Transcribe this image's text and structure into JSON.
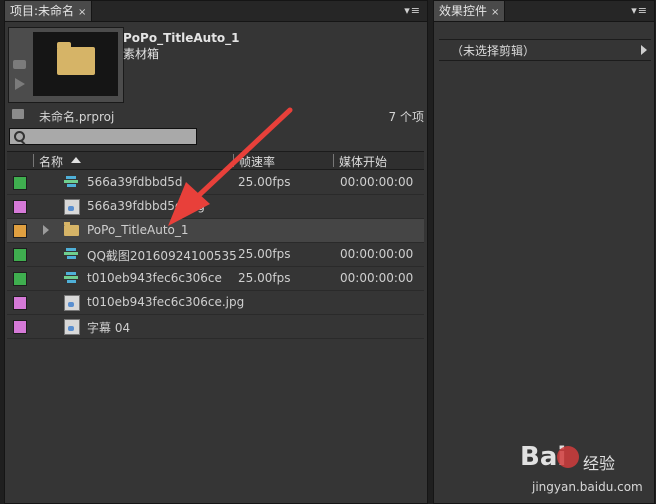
{
  "project_panel": {
    "tab_label": "项目:未命名",
    "close_glyph": "×",
    "menu_glyph": "▾≡",
    "preview": {
      "clip_name": "PoPo_TitleAuto_1",
      "clip_type": "素材箱"
    },
    "project_file": "未命名.prproj",
    "item_count": "7 个项",
    "search": {
      "value": "",
      "placeholder": ""
    },
    "columns": {
      "name": "名称",
      "fps": "帧速率",
      "media_start": "媒体开始"
    },
    "rows": [
      {
        "color": "#3fae4f",
        "icon": "sequence-icon",
        "name": "566a39fdbbd5d",
        "fps": "25.00fps",
        "start": "00:00:00:00"
      },
      {
        "color": "#d67ad8",
        "icon": "image-file-icon",
        "name": "566a39fdbbd5d.jpg",
        "fps": "",
        "start": ""
      },
      {
        "color": "#e0a040",
        "icon": "folder-icon",
        "name": "PoPo_TitleAuto_1",
        "fps": "",
        "start": ""
      },
      {
        "color": "#3fae4f",
        "icon": "sequence-icon",
        "name": "QQ截图20160924100535",
        "fps": "25.00fps",
        "start": "00:00:00:00"
      },
      {
        "color": "#3fae4f",
        "icon": "sequence-icon",
        "name": "t010eb943fec6c306ce",
        "fps": "25.00fps",
        "start": "00:00:00:00"
      },
      {
        "color": "#d67ad8",
        "icon": "image-file-icon",
        "name": "t010eb943fec6c306ce.jpg",
        "fps": "",
        "start": ""
      },
      {
        "color": "#d67ad8",
        "icon": "title-file-icon",
        "name": "字幕 04",
        "fps": "",
        "start": ""
      }
    ]
  },
  "effect_controls_panel": {
    "tab_label": "效果控件",
    "close_glyph": "×",
    "menu_glyph": "▾≡",
    "no_selection": "（未选择剪辑）"
  },
  "watermark": {
    "logo": "Bai",
    "logo_suffix": "经验",
    "url": "jingyan.baidu.com"
  },
  "annotation": {
    "arrow_color": "#e8403a"
  }
}
